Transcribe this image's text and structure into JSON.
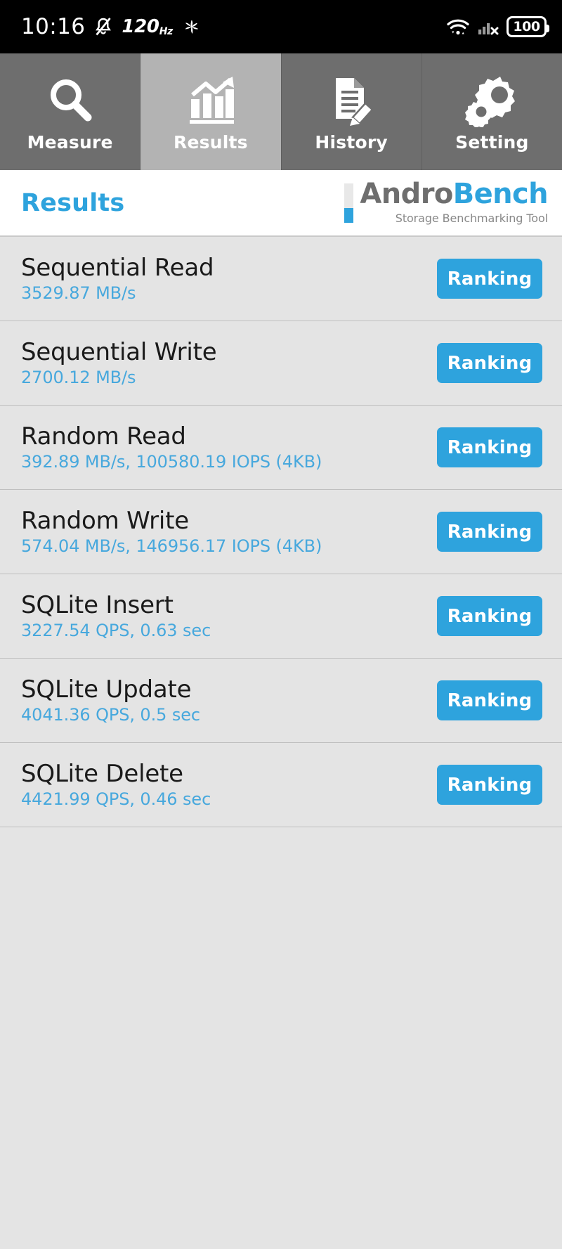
{
  "statusbar": {
    "clock": "10:16",
    "mute_icon": "bell-muted-icon",
    "refresh_rate": "120",
    "refresh_rate_unit": "Hz",
    "fan_icon": "fan-icon",
    "wifi_icon": "wifi-icon",
    "signal_icon": "cellular-no-sim-icon",
    "battery_level": "100",
    "battery_icon": "battery-icon"
  },
  "tabs": [
    {
      "label": "Measure",
      "icon": "magnifier-icon",
      "active": false
    },
    {
      "label": "Results",
      "icon": "bar-chart-arrow-icon",
      "active": true
    },
    {
      "label": "History",
      "icon": "document-pencil-icon",
      "active": false
    },
    {
      "label": "Setting",
      "icon": "gears-icon",
      "active": false
    }
  ],
  "header": {
    "title": "Results",
    "logo_andro": "Andro",
    "logo_bench": "Bench",
    "logo_subtitle": "Storage Benchmarking Tool"
  },
  "colors": {
    "accent": "#2ea3dd",
    "value_text": "#47a8dd",
    "tab_inactive": "#6e6e6e",
    "tab_active": "#b3b3b3",
    "list_bg": "#e4e4e4"
  },
  "results": [
    {
      "title": "Sequential Read",
      "value": "3529.87 MB/s",
      "button": "Ranking"
    },
    {
      "title": "Sequential Write",
      "value": "2700.12 MB/s",
      "button": "Ranking"
    },
    {
      "title": "Random Read",
      "value": "392.89 MB/s, 100580.19 IOPS (4KB)",
      "button": "Ranking"
    },
    {
      "title": "Random Write",
      "value": "574.04 MB/s, 146956.17 IOPS (4KB)",
      "button": "Ranking"
    },
    {
      "title": "SQLite Insert",
      "value": "3227.54 QPS, 0.63 sec",
      "button": "Ranking"
    },
    {
      "title": "SQLite Update",
      "value": "4041.36 QPS, 0.5 sec",
      "button": "Ranking"
    },
    {
      "title": "SQLite Delete",
      "value": "4421.99 QPS, 0.46 sec",
      "button": "Ranking"
    }
  ]
}
